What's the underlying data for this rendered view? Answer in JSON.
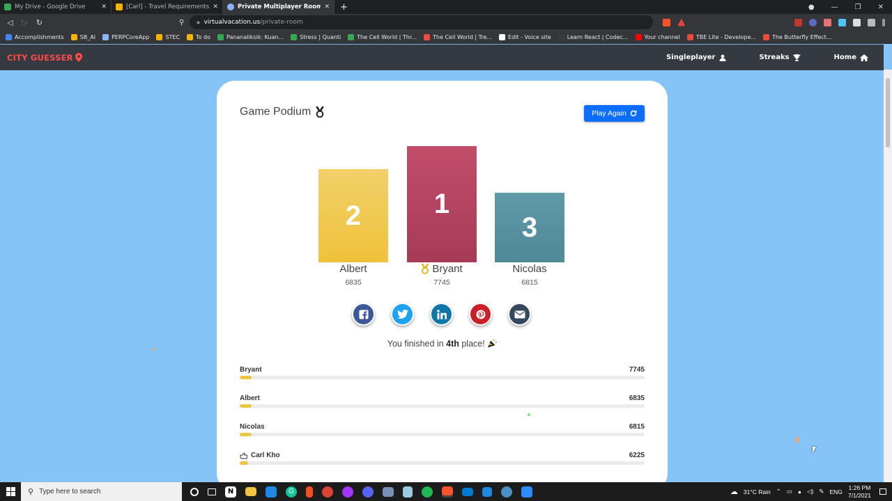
{
  "browser": {
    "tabs": [
      {
        "title": "My Drive - Google Drive",
        "icon": "google-drive-icon",
        "color": "#34a853",
        "active": false
      },
      {
        "title": "[Carl] - Travel Requirements - Google S",
        "icon": "google-slides-icon",
        "color": "#f4b400",
        "active": false
      },
      {
        "title": "Private Multiplayer Rooms - C",
        "icon": "globe-icon",
        "color": "#8ab4f8",
        "active": true
      }
    ],
    "url_host": "virtualvacation.us",
    "url_path": "/private-room",
    "bookmarks": [
      "Accomplishments",
      "SB_AI",
      "PERPCoreApp",
      "STEC",
      "To do",
      "Pananaliksik: Kuan...",
      "Stress | Quanti",
      "The Cell World | Thr...",
      "The Cell World | Tre...",
      "Edit - Voice site",
      "Learn React | Codec...",
      "Your channel",
      "TBE Lite - Develope...",
      "The Butterfly Effect..."
    ]
  },
  "site": {
    "logo_text": "CITY GUESSER",
    "nav": [
      {
        "label": "Singleplayer",
        "icon": "user-icon"
      },
      {
        "label": "Streaks",
        "icon": "trophy-icon"
      },
      {
        "label": "Home",
        "icon": "home-icon"
      }
    ]
  },
  "podium": {
    "title": "Game Podium",
    "play_again_label": "Play Again",
    "places": [
      {
        "rank": "2",
        "name": "Albert",
        "score": "6835"
      },
      {
        "rank": "1",
        "name": "Bryant",
        "score": "7745"
      },
      {
        "rank": "3",
        "name": "Nicolas",
        "score": "6815"
      }
    ],
    "share": [
      {
        "name": "facebook-share-button",
        "color": "#3b5998"
      },
      {
        "name": "twitter-share-button",
        "color": "#1da1f2"
      },
      {
        "name": "linkedin-share-button",
        "color": "#0e76a8"
      },
      {
        "name": "pinterest-share-button",
        "color": "#cb2027"
      },
      {
        "name": "email-share-button",
        "color": "#34495e"
      }
    ],
    "finish_prefix": "You finished in",
    "finish_place": "4th",
    "finish_suffix": "place!"
  },
  "leaderboard": [
    {
      "name": "Bryant",
      "score": "7745",
      "progress_pct": 3
    },
    {
      "name": "Albert",
      "score": "6835",
      "progress_pct": 3
    },
    {
      "name": "Nicolas",
      "score": "6815",
      "progress_pct": 3
    },
    {
      "name": "Carl Kho",
      "score": "6225",
      "progress_pct": 2,
      "you": true
    }
  ],
  "taskbar": {
    "search_placeholder": "Type here to search",
    "weather": "31°C  Rain",
    "lang": "ENG",
    "time": "1:26 PM",
    "date": "7/1/2021"
  },
  "colors": {
    "page_bg": "#86c4f7",
    "accent": "#0d6efd",
    "gold": "#efc23a",
    "crimson": "#a63b56",
    "teal": "#4f8896"
  }
}
